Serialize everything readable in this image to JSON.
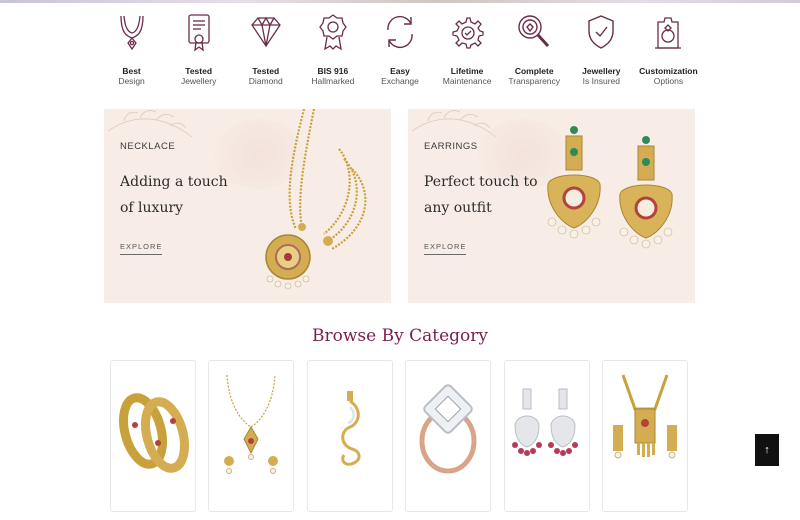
{
  "features": [
    {
      "icon": "necklace-icon",
      "title": "Best",
      "subtitle": "Design"
    },
    {
      "icon": "certificate-icon",
      "title": "Tested",
      "subtitle": "Jewellery"
    },
    {
      "icon": "diamond-icon",
      "title": "Tested",
      "subtitle": "Diamond"
    },
    {
      "icon": "hallmark-badge-icon",
      "title": "BIS 916",
      "subtitle": "Hallmarked"
    },
    {
      "icon": "exchange-arrows-icon",
      "title": "Easy",
      "subtitle": "Exchange"
    },
    {
      "icon": "maintenance-gear-icon",
      "title": "Lifetime",
      "subtitle": "Maintenance"
    },
    {
      "icon": "magnifier-icon",
      "title": "Complete",
      "subtitle": "Transparency"
    },
    {
      "icon": "shield-check-icon",
      "title": "Jewellery",
      "subtitle": "Is Insured"
    },
    {
      "icon": "customization-ring-icon",
      "title": "Customization",
      "subtitle": "Options"
    }
  ],
  "banners": [
    {
      "kicker": "NECKLACE",
      "headline": "Adding a touch of luxury",
      "cta": "EXPLORE"
    },
    {
      "kicker": "EARRINGS",
      "headline": "Perfect touch to any outfit",
      "cta": "EXPLORE"
    }
  ],
  "browse": {
    "title": "Browse By Category",
    "categories": [
      {
        "image": "bangles"
      },
      {
        "image": "pendant-set"
      },
      {
        "image": "pendant"
      },
      {
        "image": "diamond-ring"
      },
      {
        "image": "earrings"
      },
      {
        "image": "necklace-set"
      }
    ]
  },
  "scroll_top": {
    "label": "↑"
  },
  "colors": {
    "accent": "#7a1f4d",
    "icon": "#6d2b4a",
    "banner_bg": "#f8ede6",
    "gold": "#c9a13b"
  }
}
